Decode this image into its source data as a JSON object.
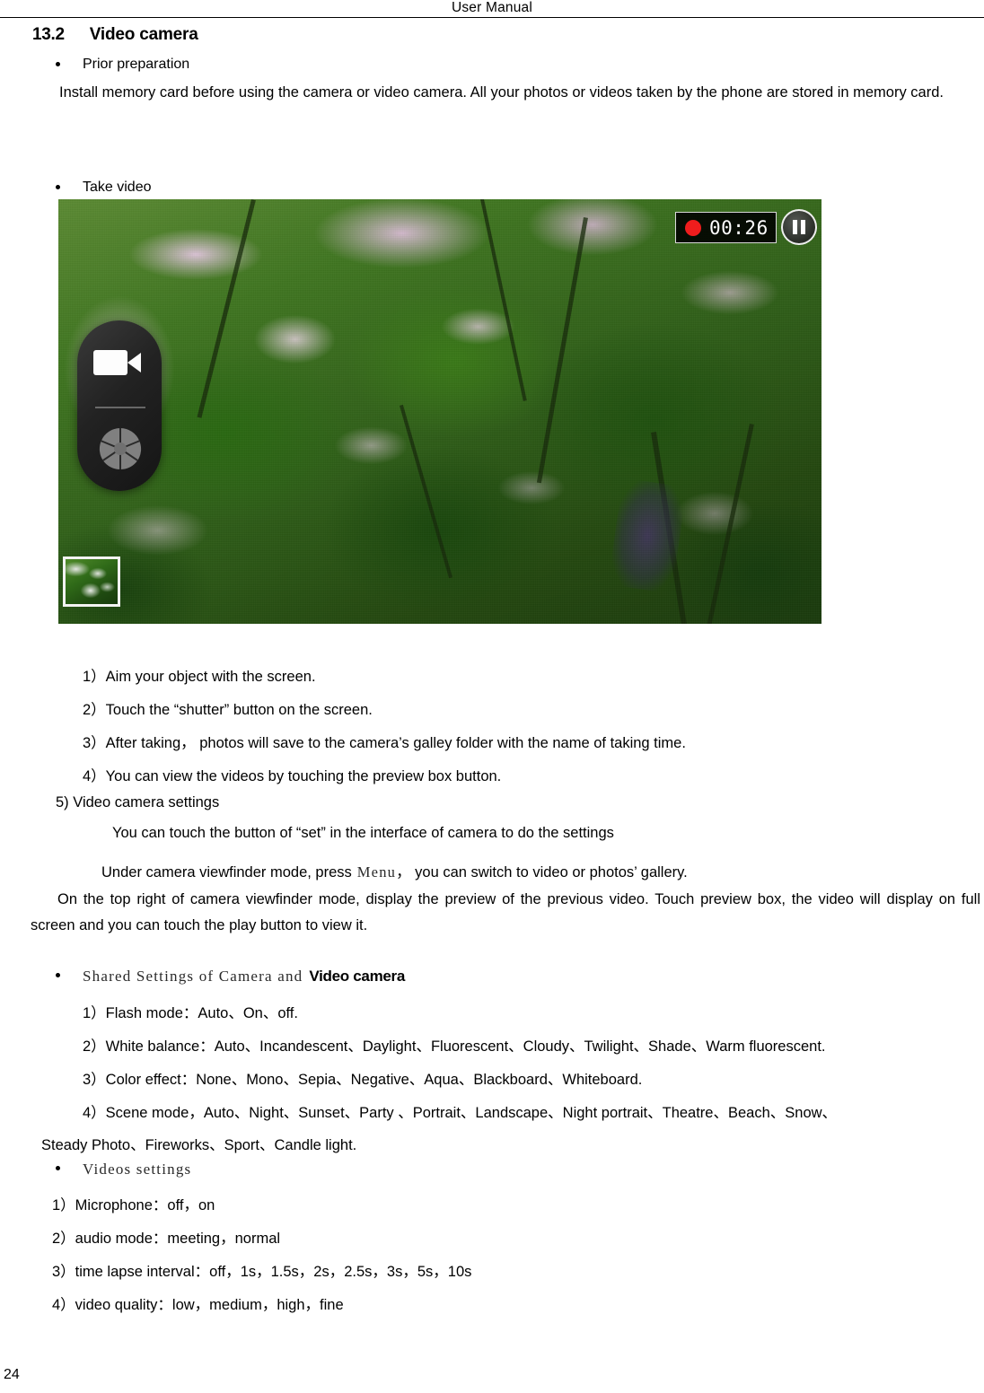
{
  "header": {
    "running_head": "User   Manual"
  },
  "section": {
    "number": "13.2",
    "title": "Video camera"
  },
  "bullets": {
    "prior_preparation": "Prior preparation",
    "take_video": "Take video",
    "shared_settings_serif": "Shared Settings of Camera and",
    "shared_settings_bold": "Video camera",
    "videos_settings": "Videos settings"
  },
  "paragraphs": {
    "install_memory": "Install memory card before using the camera or video camera. All your photos or videos taken by the phone are stored in memory card.",
    "settings_note": "You can touch the button of “set” in the interface of camera to do the settings",
    "viewfinder_pre": "Under camera viewfinder mode, press",
    "viewfinder_menu": "Menu",
    "viewfinder_post": "， you can switch to video or photos’ gallery.",
    "top_right_note": "On the top right of camera viewfinder mode, display the preview of the previous video. Touch preview box, the video will display on full screen and you can touch the play button to view it."
  },
  "steps": [
    "1）Aim your object with the screen.",
    "2）Touch the “shutter” button on the screen.",
    "3）After taking， photos will save to the camera’s galley folder with the name of taking time.",
    "4）You can view the videos by touching the preview box button.",
    "5) Video camera settings"
  ],
  "shared_settings_items": [
    "1）Flash mode：Auto、On、off.",
    "2）White balance：Auto、Incandescent、Daylight、Fluorescent、Cloudy、Twilight、Shade、Warm fluorescent.",
    "3）Color effect：None、Mono、Sepia、Negative、Aqua、Blackboard、Whiteboard.",
    "4）Scene mode，Auto、Night、Sunset、Party 、Portrait、Landscape、Night portrait、Theatre、Beach、Snow、",
    "Steady Photo、Fireworks、Sport、Candle light."
  ],
  "videos_settings_items": [
    "1）Microphone：off，on",
    "2）audio mode：meeting，normal",
    "3）time lapse interval：off，1s，1.5s，2s，2.5s，3s，5s，10s",
    "4）video quality：low，medium，high，fine"
  ],
  "viewfinder": {
    "rec_time": "00:26",
    "rec_dot_color": "#ef1d1d",
    "pause_label": "pause",
    "video_mode_icon": "video-camera-icon",
    "shutter_icon": "shutter-aperture-icon",
    "thumbnail_label": "preview-thumbnail"
  },
  "footer": {
    "page_number": "24"
  }
}
